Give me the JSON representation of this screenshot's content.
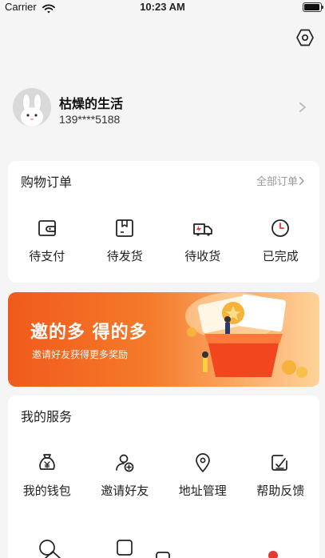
{
  "status_bar": {
    "carrier": "Carrier",
    "time": "10:23 AM",
    "battery_level": 0.95
  },
  "icons": {
    "settings": "hexagon-settings-icon",
    "wifi": "wifi-icon",
    "battery": "battery-icon"
  },
  "profile": {
    "nickname": "枯燥的生活",
    "phone": "139****5188",
    "avatar": "bunny-avatar"
  },
  "orders": {
    "title": "购物订单",
    "all_link": "全部订单",
    "items": [
      {
        "label": "待支付",
        "icon": "wallet-icon"
      },
      {
        "label": "待发货",
        "icon": "package-icon"
      },
      {
        "label": "待收货",
        "icon": "delivery-truck-icon"
      },
      {
        "label": "已完成",
        "icon": "clock-icon"
      }
    ]
  },
  "banner": {
    "title": "邀的多 得的多",
    "subtitle": "邀请好友获得更多奖励"
  },
  "services": {
    "title": "我的服务",
    "items": [
      {
        "label": "我的钱包",
        "icon": "money-bag-icon"
      },
      {
        "label": "邀请好友",
        "icon": "add-user-icon"
      },
      {
        "label": "地址管理",
        "icon": "location-pin-icon"
      },
      {
        "label": "帮助反馈",
        "icon": "feedback-icon"
      }
    ]
  },
  "colors": {
    "accent": "#f05a1c",
    "background": "#f5f5f5",
    "badge": "#e53935"
  }
}
